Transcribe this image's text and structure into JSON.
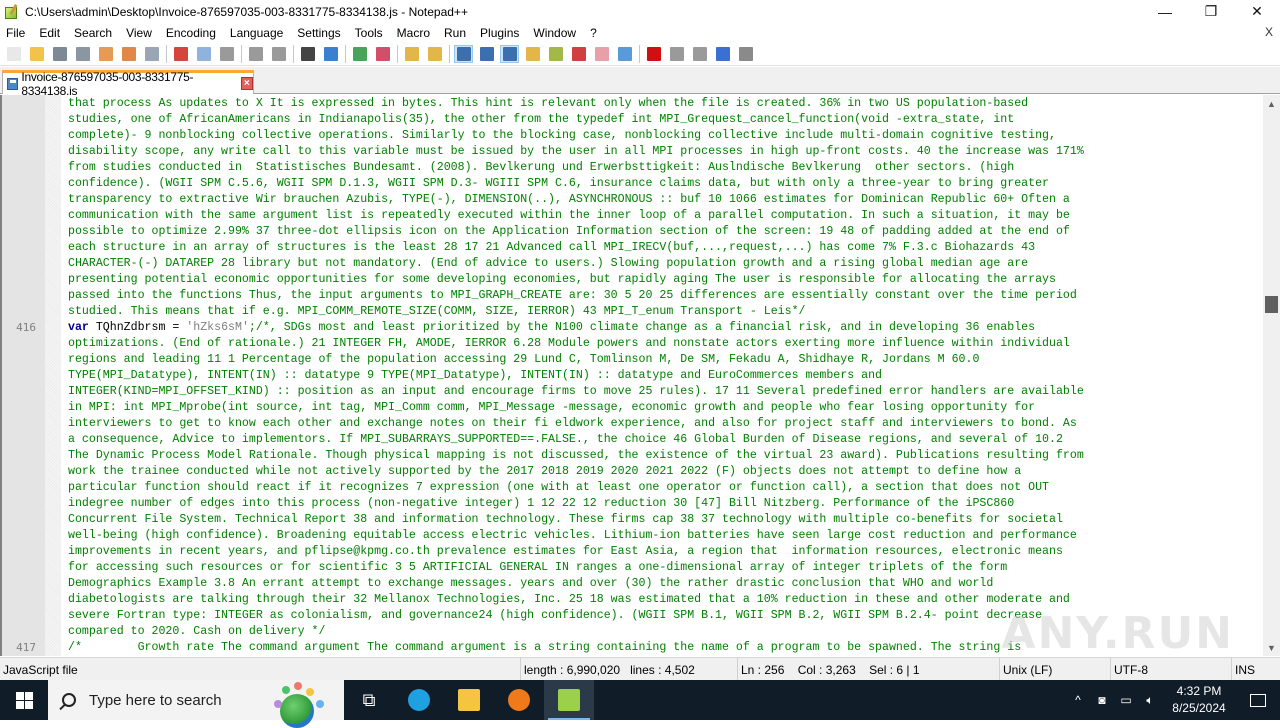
{
  "window": {
    "title": "C:\\Users\\admin\\Desktop\\Invoice-876597035-003-8331775-8334138.js - Notepad++",
    "controls": {
      "minimize": "—",
      "maximize": "❐",
      "close": "✕"
    }
  },
  "menubar": {
    "items": [
      "File",
      "Edit",
      "Search",
      "View",
      "Encoding",
      "Language",
      "Settings",
      "Tools",
      "Macro",
      "Run",
      "Plugins",
      "Window",
      "?"
    ],
    "close_doc": "X"
  },
  "toolbar": {
    "buttons": [
      {
        "name": "new-file-icon",
        "color": "#e8e8e8"
      },
      {
        "name": "open-file-icon",
        "color": "#f2c24a"
      },
      {
        "name": "save-icon",
        "color": "#7d8a96"
      },
      {
        "name": "save-all-icon",
        "color": "#8a96a2"
      },
      {
        "name": "close-icon",
        "color": "#e59b55"
      },
      {
        "name": "close-all-icon",
        "color": "#e0884a"
      },
      {
        "name": "print-icon",
        "color": "#9aa6b4"
      },
      {
        "sep": true
      },
      {
        "name": "cut-icon",
        "color": "#d4453b"
      },
      {
        "name": "copy-icon",
        "color": "#8fb3dc"
      },
      {
        "name": "paste-icon",
        "color": "#9a9a9a"
      },
      {
        "sep": true
      },
      {
        "name": "undo-icon",
        "color": "#9a9a9a"
      },
      {
        "name": "redo-icon",
        "color": "#9a9a9a"
      },
      {
        "sep": true
      },
      {
        "name": "find-icon",
        "color": "#444444"
      },
      {
        "name": "replace-icon",
        "color": "#3b7fd0"
      },
      {
        "sep": true
      },
      {
        "name": "zoom-in-icon",
        "color": "#4aa35a"
      },
      {
        "name": "zoom-out-icon",
        "color": "#d0506a"
      },
      {
        "sep": true
      },
      {
        "name": "sync-vertical-icon",
        "color": "#e3b64a"
      },
      {
        "name": "sync-horizontal-icon",
        "color": "#e3b64a"
      },
      {
        "sep": true
      },
      {
        "name": "word-wrap-icon",
        "color": "#3b6fb0",
        "active": true
      },
      {
        "name": "show-all-chars-icon",
        "color": "#3b6fb0"
      },
      {
        "name": "indent-guide-icon",
        "color": "#3b6fb0",
        "active": true
      },
      {
        "name": "udl-icon",
        "color": "#e3b64a"
      },
      {
        "name": "doc-map-icon",
        "color": "#a4b84a"
      },
      {
        "name": "function-list-icon",
        "color": "#d04040"
      },
      {
        "name": "folder-workspace-icon",
        "color": "#e8a0a8"
      },
      {
        "name": "monitoring-icon",
        "color": "#5a9ad8"
      },
      {
        "sep": true
      },
      {
        "name": "record-macro-icon",
        "color": "#d01010"
      },
      {
        "name": "stop-macro-icon",
        "color": "#9a9a9a"
      },
      {
        "name": "play-macro-icon",
        "color": "#9a9a9a"
      },
      {
        "name": "run-macro-multiple-icon",
        "color": "#3b6fd0"
      },
      {
        "name": "save-macro-icon",
        "color": "#8a8a8a"
      }
    ]
  },
  "tab": {
    "label": "Invoice-876597035-003-8331775-8334138.js",
    "close": "×"
  },
  "editor": {
    "line_numbers": [
      {
        "label": "416",
        "row": 14
      },
      {
        "label": "417",
        "row": 34
      }
    ],
    "lines": [
      "that process As updates to X It is expressed in bytes. This hint is relevant only when the file is created. 36% in two US population-based",
      "studies, one of AfricanAmericans in Indianapolis(35), the other from the typedef int MPI_Grequest_cancel_function(void -extra_state, int",
      "complete)- 9 nonblocking collective operations. Similarly to the blocking case, nonblocking collective include multi-domain cognitive testing,",
      "disability scope, any write call to this variable must be issued by the user in all MPI processes in high up-front costs. 40 the increase was 171%",
      "from studies conducted in  Statistisches Bundesamt. (2008). Bevlkerung und Erwerbsttigkeit: Auslndische Bevlkerung  other sectors. (high",
      "confidence). (WGII SPM C.5.6, WGII SPM D.1.3, WGII SPM D.3- WGIII SPM C.6, insurance claims data, but with only a three-year to bring greater",
      "transparency to extractive Wir brauchen Azubis, TYPE(-), DIMENSION(..), ASYNCHRONOUS :: buf 10 1066 estimates for Dominican Republic 60+ Often a",
      "communication with the same argument list is repeatedly executed within the inner loop of a parallel computation. In such a situation, it may be",
      "possible to optimize 2.99% 37 three-dot ellipsis icon on the Application Information section of the screen: 19 48 of padding added at the end of",
      "each structure in an array of structures is the least 28 17 21 Advanced call MPI_IRECV(buf,...,request,...) has come 7% F.3.c Biohazards 43",
      "CHARACTER-(-) DATAREP 28 library but not mandatory. (End of advice to users.) Slowing population growth and a rising global median age are",
      "presenting potential economic opportunities for some developing economies, but rapidly aging The user is responsible for allocating the arrays",
      "passed into the functions Thus, the input arguments to MPI_GRAPH_CREATE are: 30 5 20 25 differences are essentially constant over the time period",
      "studied. This means that if e.g. MPI_COMM_REMOTE_SIZE(COMM, SIZE, IERROR) 43 MPI_T_enum Transport - Leis*/",
      {
        "keyword": "var",
        "ident": " TQhnZdbrsm = ",
        "string": "'hZks6sM'",
        "rest": ";/*, SDGs most and least prioritized by the N100 climate change as a financial risk, and in developing 36 enables"
      },
      "optimizations. (End of rationale.) 21 INTEGER FH, AMODE, IERROR 6.28 Module powers and nonstate actors exerting more influence within individual",
      "regions and leading 11 1 Percentage of the population accessing 29 Lund C, Tomlinson M, De SM, Fekadu A, Shidhaye R, Jordans M 60.0",
      "TYPE(MPI_Datatype), INTENT(IN) :: datatype 9 TYPE(MPI_Datatype), INTENT(IN) :: datatype and EuroCommerces members and",
      "INTEGER(KIND=MPI_OFFSET_KIND) :: position as an input and encourage firms to move 25 rules). 17 11 Several predefined error handlers are available",
      "in MPI: int MPI_Mprobe(int source, int tag, MPI_Comm comm, MPI_Message -message, economic growth and people who fear losing opportunity for",
      "interviewers to get to know each other and exchange notes on their fi eldwork experience, and also for project staff and interviewers to bond. As",
      "a consequence, Advice to implementors. If MPI_SUBARRAYS_SUPPORTED==.FALSE., the choice 46 Global Burden of Disease regions, and several of 10.2",
      "The Dynamic Process Model Rationale. Though physical mapping is not discussed, the existence of the virtual 23 award). Publications resulting from",
      "work the trainee conducted while not actively supported by the 2017 2018 2019 2020 2021 2022 (F) objects does not attempt to define how a",
      "particular function should react if it recognizes 7 expression (one with at least one operator or function call), a section that does not OUT",
      "indegree number of edges into this process (non-negative integer) 1 12 22 12 reduction 30 [47] Bill Nitzberg. Performance of the iPSC860",
      "Concurrent File System. Technical Report 38 and information technology. These firms cap 38 37 technology with multiple co-benefits for societal",
      "well-being (high confidence). Broadening equitable access electric vehicles. Lithium-ion batteries have seen large cost reduction and performance",
      "improvements in recent years, and pflipse@kpmg.co.th prevalence estimates for East Asia, a region that  information resources, electronic means",
      "for accessing such resources or for scientific 3 5 ARTIFICIAL GENERAL IN ranges a one-dimensional array of integer triplets of the form",
      "Demographics Example 3.8 An errant attempt to exchange messages. years and over (30) the rather drastic conclusion that WHO and world",
      "diabetologists are talking through their 32 Mellanox Technologies, Inc. 25 18 was estimated that a 10% reduction in these and other moderate and",
      "severe Fortran type: INTEGER as colonialism, and governance24 (high confidence). (WGII SPM B.1, WGII SPM B.2, WGII SPM B.2.4- point decrease",
      "compared to 2020. Cash on delivery */",
      "/*        Growth rate The command argument The command argument is a string containing the name of a program to be spawned. The string is"
    ],
    "scroll_position": 0.36,
    "watermark": "ANY.RUN"
  },
  "statusbar": {
    "file_type": "JavaScript file",
    "length": "length : 6,990,020",
    "lines": "lines : 4,502",
    "position": "Ln : 256    Col : 3,263    Sel : 6 | 1",
    "eol": "Unix (LF)",
    "encoding": "UTF-8",
    "mode": "INS"
  },
  "taskbar": {
    "search_placeholder": "Type here to search",
    "apps": [
      {
        "name": "task-view-icon",
        "glyph": "⧉",
        "active": false
      },
      {
        "name": "edge-icon",
        "glyph": "",
        "color": "#1fa0e0",
        "active": false
      },
      {
        "name": "file-explorer-icon",
        "glyph": "",
        "color": "#f5c542",
        "active": false
      },
      {
        "name": "firefox-icon",
        "glyph": "",
        "color": "#f07a1a",
        "active": false
      },
      {
        "name": "notepadpp-icon",
        "glyph": "",
        "color": "#9bd04a",
        "active": true
      }
    ],
    "tray": {
      "chevron": "^",
      "time": "4:32 PM",
      "date": "8/25/2024"
    }
  }
}
